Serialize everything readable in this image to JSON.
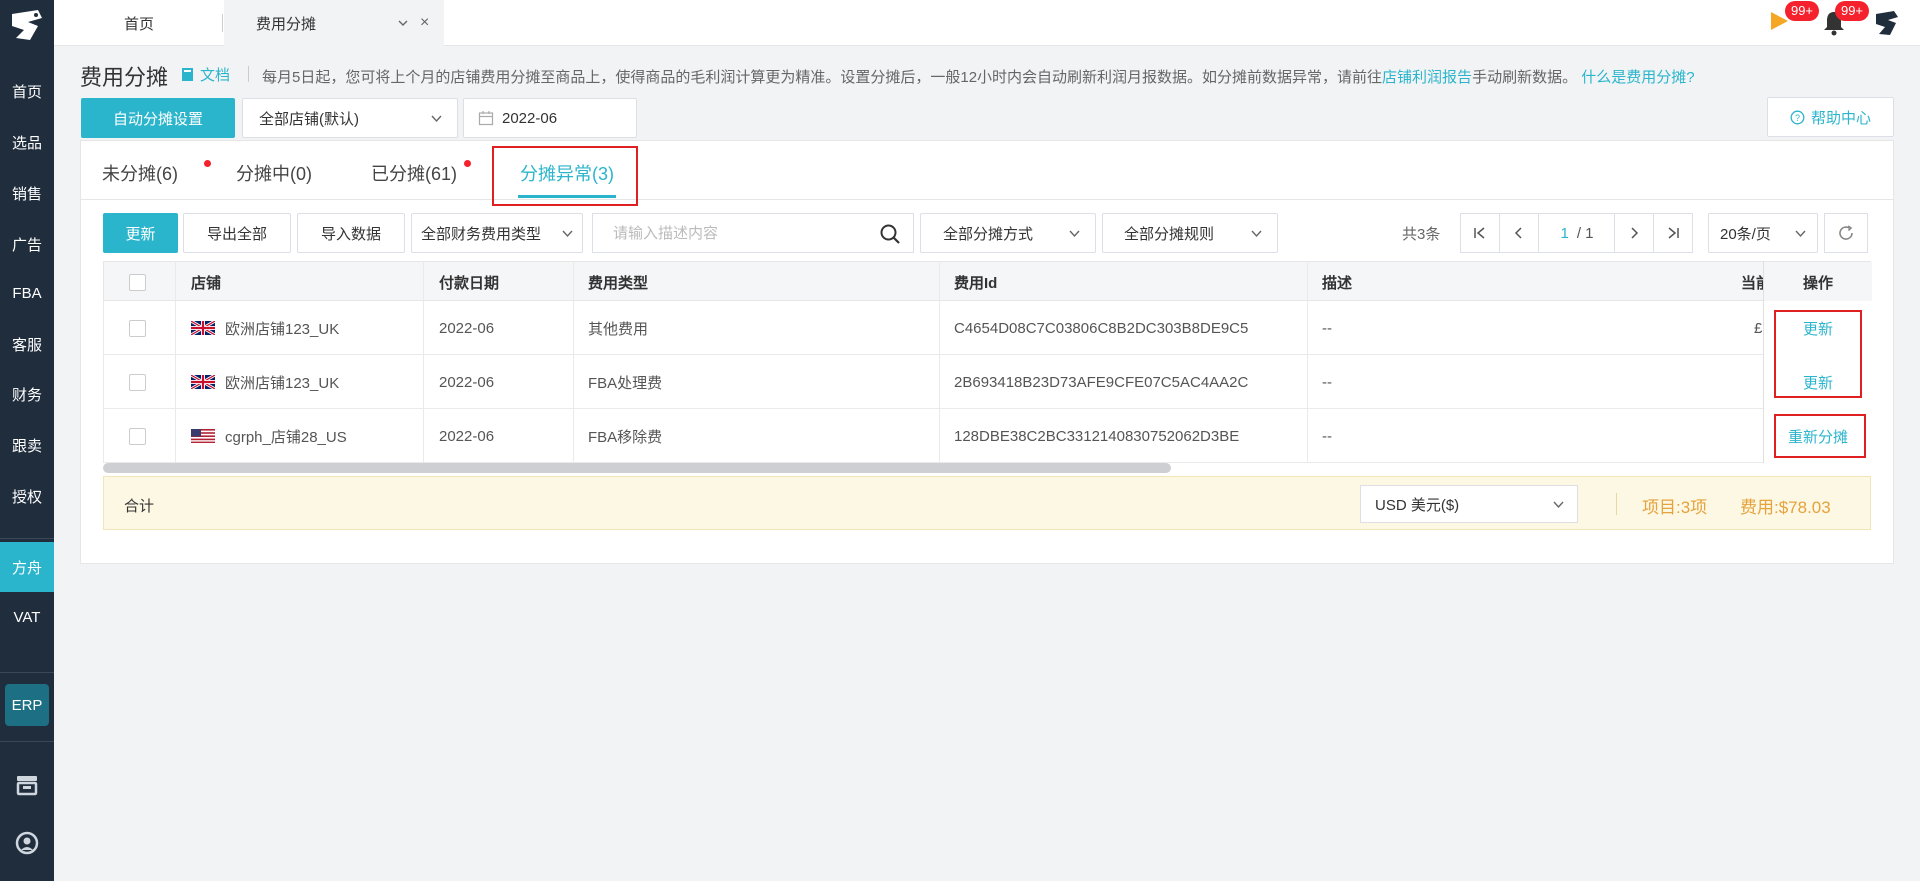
{
  "sidebar": {
    "items": [
      {
        "label": "首页"
      },
      {
        "label": "选品"
      },
      {
        "label": "销售"
      },
      {
        "label": "广告"
      },
      {
        "label": "FBA"
      },
      {
        "label": "客服"
      },
      {
        "label": "财务"
      },
      {
        "label": "跟卖"
      },
      {
        "label": "授权"
      },
      {
        "label": "方舟"
      },
      {
        "label": "VAT"
      }
    ],
    "erp_label": "ERP",
    "active_item": "方舟"
  },
  "topbar": {
    "home_tab": "首页",
    "current_tab": "费用分摊",
    "close_glyph": "×",
    "flag_badge": "99+",
    "bell_badge": "99+"
  },
  "header": {
    "title": "费用分摊",
    "doc_link": "文档",
    "notice_prefix": "每月5日起，您可将上个月的店铺费用分摊至商品上，使得商品的毛利润计算更为精准。设置分摊后，一般12小时内会自动刷新利润月报数据。如分摊前数据异常，请前往",
    "notice_link": "店铺利润报告",
    "notice_suffix": "手动刷新数据。",
    "notice_help_link": "什么是费用分摊?"
  },
  "controls": {
    "auto_setting_button": "自动分摊设置",
    "store_select": "全部店铺(默认)",
    "date_value": "2022-06",
    "help_center": "帮助中心"
  },
  "tabs": [
    {
      "label": "未分摊(6)",
      "dot": true
    },
    {
      "label": "分摊中(0)",
      "dot": false
    },
    {
      "label": "已分摊(61)",
      "dot": true
    },
    {
      "label": "分摊异常(3)",
      "dot": false,
      "active": true
    }
  ],
  "toolbar": {
    "update_button": "更新",
    "export_button": "导出全部",
    "import_button": "导入数据",
    "fee_type_select": "全部财务费用类型",
    "search_placeholder": "请输入描述内容",
    "method_select": "全部分摊方式",
    "rule_select": "全部分摊规则",
    "total_count": "共3条",
    "page_current": "1",
    "page_total": "/ 1",
    "page_size": "20条/页"
  },
  "table": {
    "columns": [
      "店铺",
      "付款日期",
      "费用类型",
      "费用Id",
      "描述",
      "当前",
      "操作"
    ],
    "rows": [
      {
        "store": "欧洲店铺123_UK",
        "flag": "uk",
        "date": "2022-06",
        "fee_type": "其他费用",
        "fee_id": "C4654D08C7C03806C8B2DC303B8DE9C5",
        "desc": "--",
        "current": "£",
        "action": "更新"
      },
      {
        "store": "欧洲店铺123_UK",
        "flag": "uk",
        "date": "2022-06",
        "fee_type": "FBA处理费",
        "fee_id": "2B693418B23D73AFE9CFE07C5AC4AA2C",
        "desc": "--",
        "current": "",
        "action": "更新"
      },
      {
        "store": "cgrph_店铺28_US",
        "flag": "us",
        "date": "2022-06",
        "fee_type": "FBA移除费",
        "fee_id": "128DBE38C2BC3312140830752062D3BE",
        "desc": "--",
        "current": "",
        "action": "重新分摊"
      }
    ]
  },
  "summary": {
    "label": "合计",
    "currency": "USD  美元($)",
    "items": "项目:3项",
    "fee": "费用:$78.03"
  },
  "colors": {
    "accent": "#2bb5cc",
    "sidebar": "#1f2d3d",
    "highlight": "#e02020",
    "total": "#e6a23c"
  }
}
